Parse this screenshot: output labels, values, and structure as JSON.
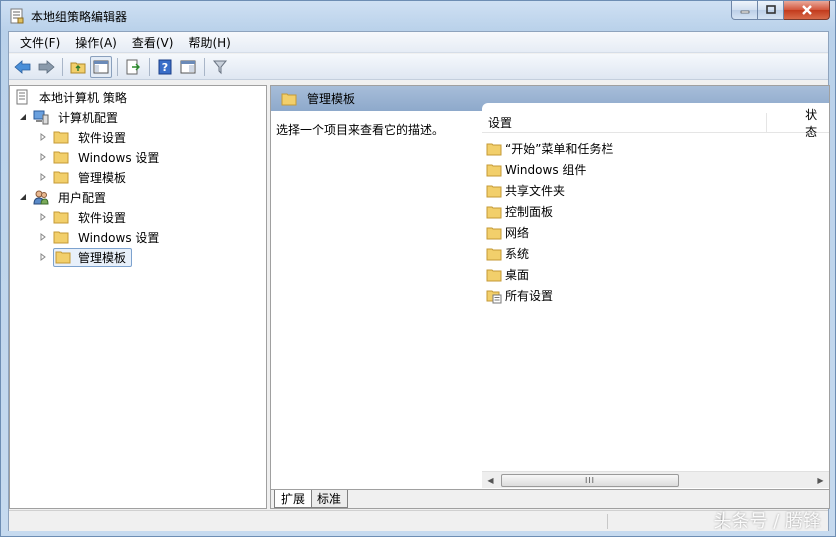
{
  "window": {
    "title": "本地组策略编辑器"
  },
  "menu": [
    {
      "label": "文件(F)"
    },
    {
      "label": "操作(A)"
    },
    {
      "label": "查看(V)"
    },
    {
      "label": "帮助(H)"
    }
  ],
  "tree": {
    "root": "本地计算机 策略",
    "computer_config": "计算机配置",
    "computer_children": [
      "软件设置",
      "Windows 设置",
      "管理模板"
    ],
    "user_config": "用户配置",
    "user_children": [
      "软件设置",
      "Windows 设置",
      "管理模板"
    ]
  },
  "right": {
    "header_title": "管理模板",
    "description": "选择一个项目来查看它的描述。",
    "col_settings": "设置",
    "col_state": "状态",
    "items": [
      "“开始”菜单和任务栏",
      "Windows 组件",
      "共享文件夹",
      "控制面板",
      "网络",
      "系统",
      "桌面",
      "所有设置"
    ],
    "scroll_grip": "III"
  },
  "tabs": [
    "扩展",
    "标准"
  ],
  "watermark": "头条号 / 腾锋",
  "colors": {
    "header": "#8ea9cb",
    "folder": "#f2cf6b",
    "selection": "#e8f0fa"
  }
}
